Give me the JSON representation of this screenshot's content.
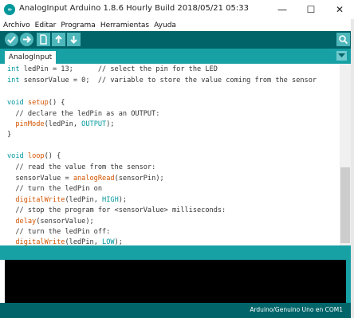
{
  "window": {
    "title": "AnalogInput Arduino 1.8.6 Hourly Build 2018/05/21 05:33",
    "app_icon_text": "∞",
    "controls": {
      "minimize": "—",
      "maximize": "☐",
      "close": "✕"
    }
  },
  "menu": [
    "Archivo",
    "Editar",
    "Programa",
    "Herramientas",
    "Ayuda"
  ],
  "toolbar": {
    "buttons": [
      "verify-icon",
      "upload-icon",
      "new-icon",
      "open-icon",
      "save-icon"
    ],
    "serial_monitor": "serial-monitor-icon",
    "colors": {
      "bar": "#006468",
      "button": "#4db7bb"
    }
  },
  "tabs": [
    {
      "label": "AnalogInput"
    }
  ],
  "tab_menu_icon": "dropdown-arrow-icon",
  "code": {
    "lines": [
      "int ledPin = 13;      // select the pin for the LED",
      "int sensorValue = 0;  // variable to store the value coming from the sensor",
      "",
      "void setup() {",
      "  // declare the ledPin as an OUTPUT:",
      "  pinMode(ledPin, OUTPUT);",
      "}",
      "",
      "void loop() {",
      "  // read the value from the sensor:",
      "  sensorValue = analogRead(sensorPin);",
      "  // turn the ledPin on",
      "  digitalWrite(ledPin, HIGH);",
      "  // stop the program for <sensorValue> milliseconds:",
      "  delay(sensorValue);",
      "  // turn the ledPin off:",
      "  digitalWrite(ledPin, LOW);"
    ],
    "colors": {
      "keyword": "#00979c",
      "function": "#d35400",
      "text": "#333333"
    }
  },
  "status": {
    "board": "Arduino/Genuino Uno en COM1"
  }
}
